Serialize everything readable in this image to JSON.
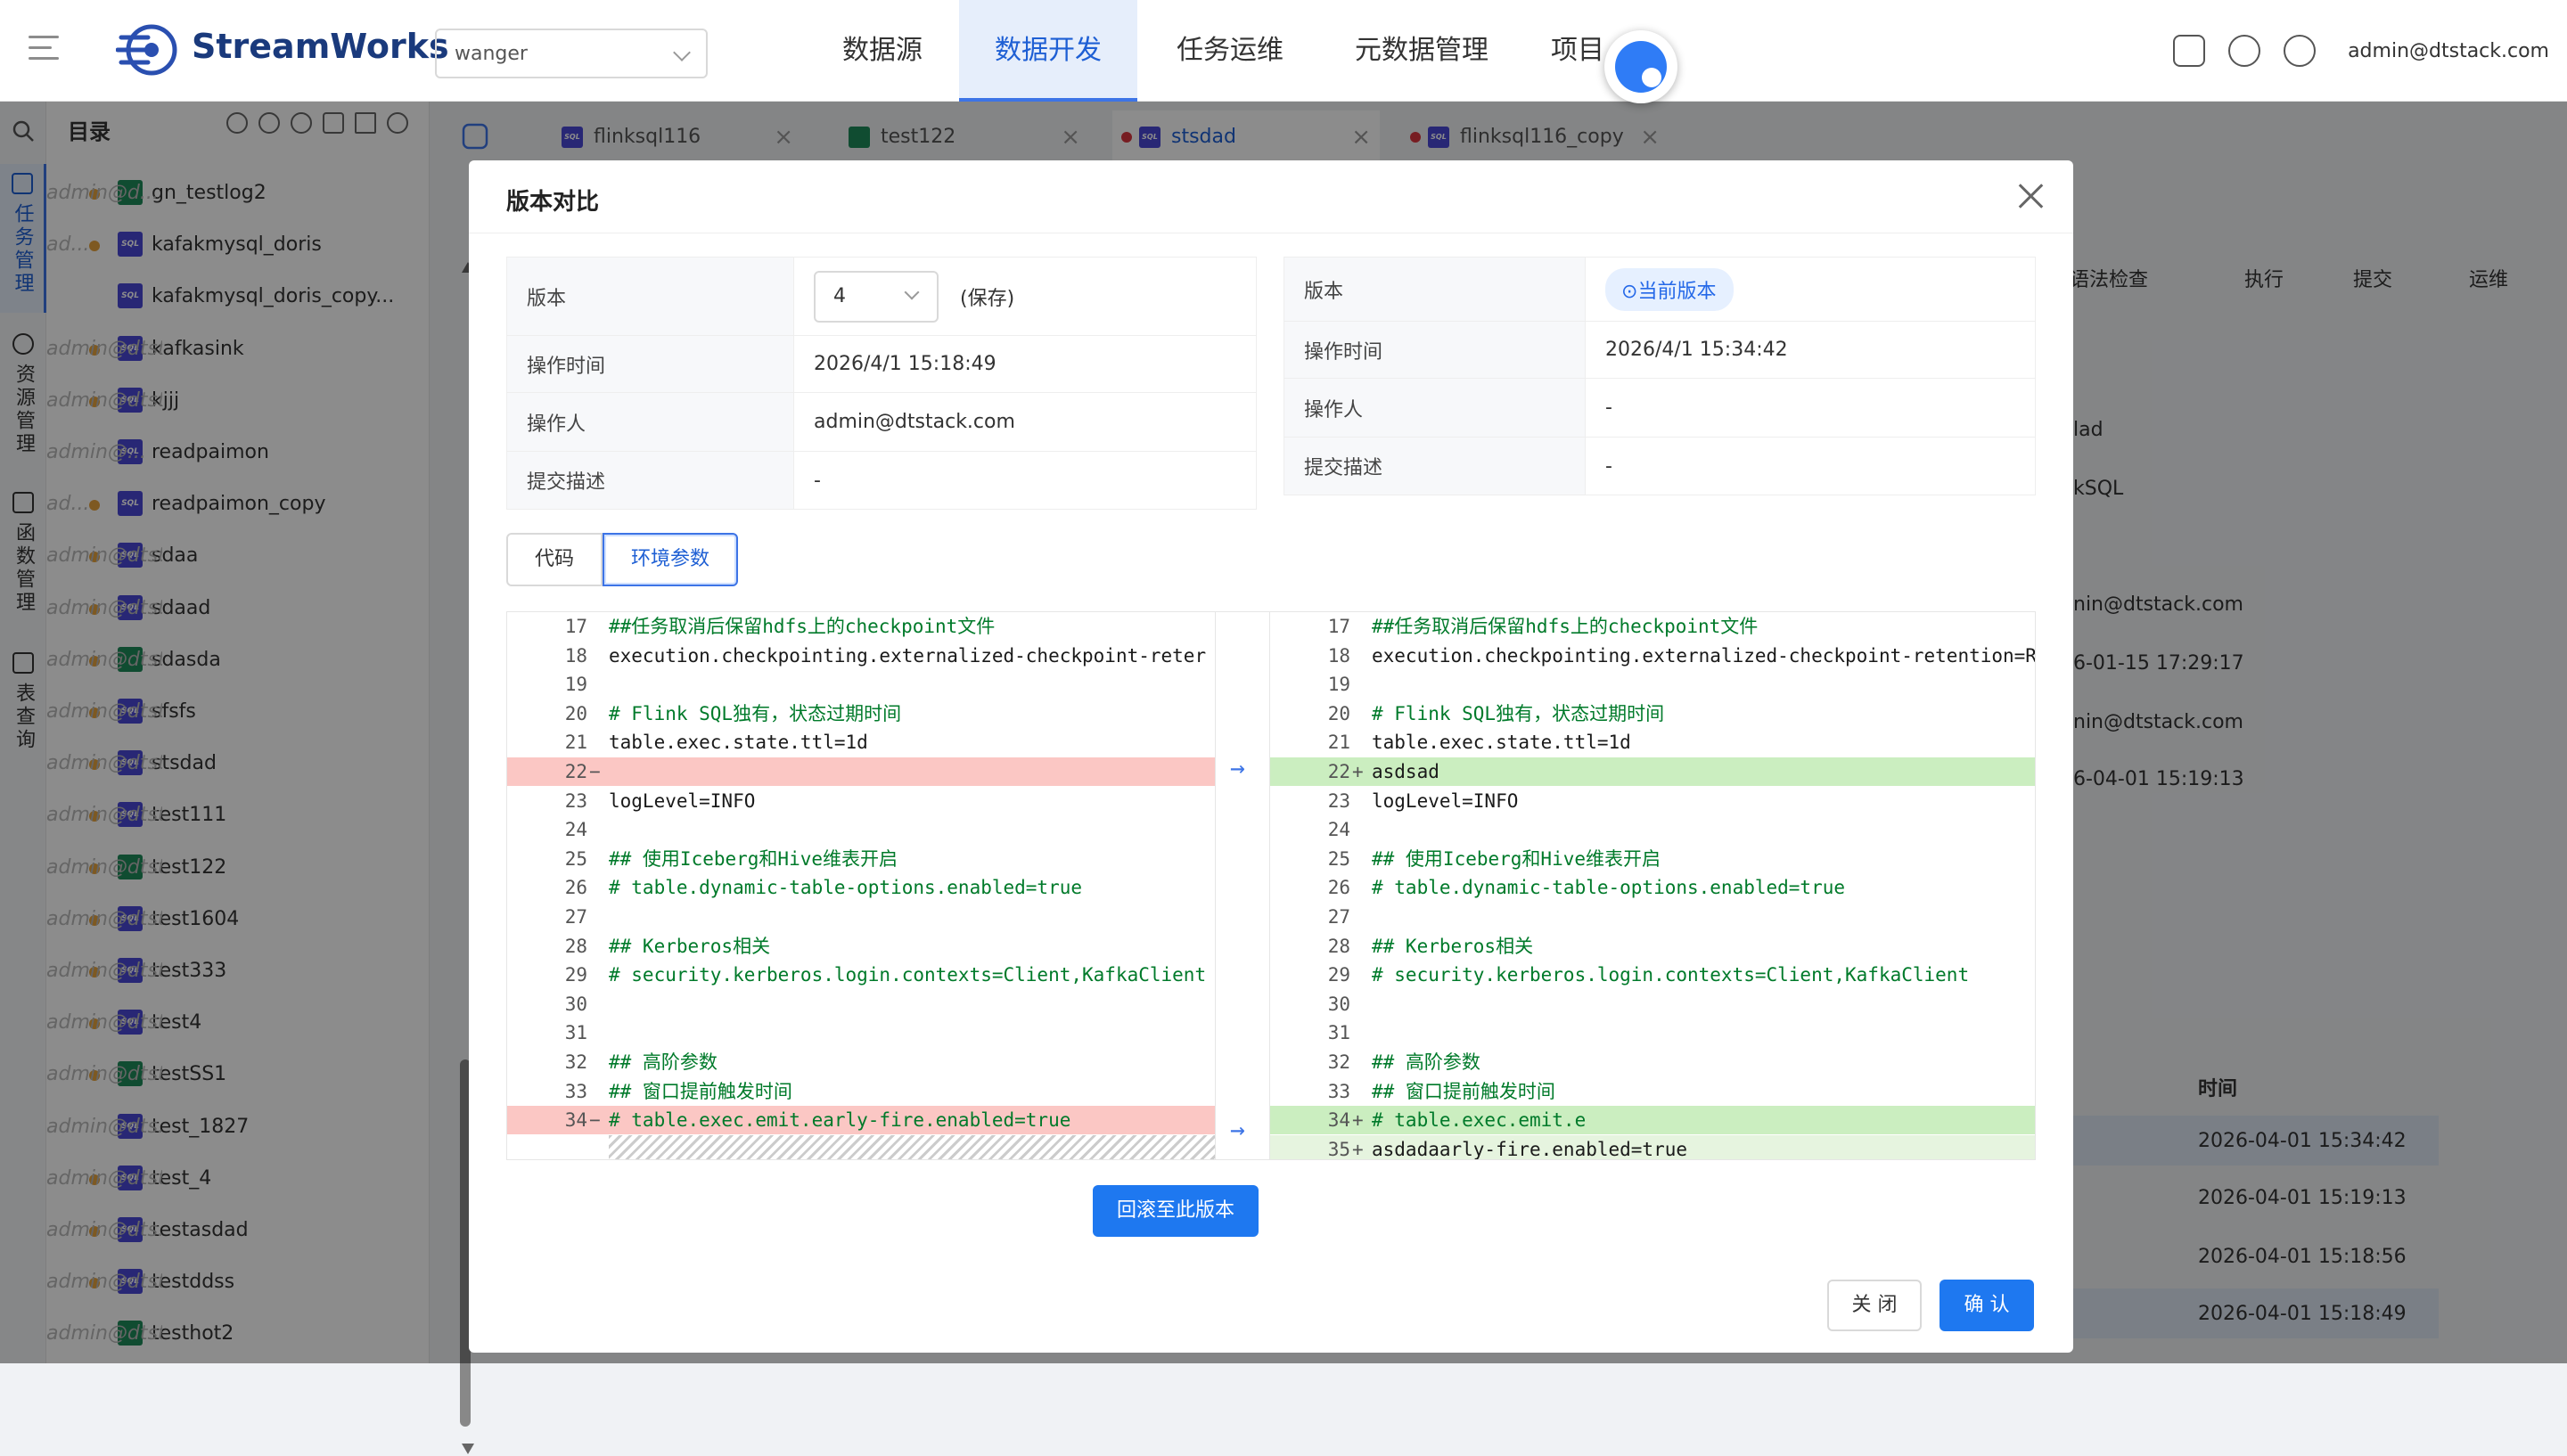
{
  "header": {
    "brand": "StreamWorks",
    "tenant": "wanger",
    "nav": [
      "数据源",
      "数据开发",
      "任务运维",
      "元数据管理",
      "项目"
    ],
    "active_nav": "数据开发",
    "user": "admin@dtstack.com"
  },
  "sidebar": {
    "items": [
      "任务管理",
      "资源管理",
      "函数管理",
      "表查询"
    ]
  },
  "tree": {
    "title": "目录",
    "items": [
      {
        "name": "gn_testlog2",
        "owner": "admin@d...",
        "type": "grid",
        "dot": true
      },
      {
        "name": "kafakmysql_doris",
        "owner": "ad...",
        "type": "sql",
        "dot": true
      },
      {
        "name": "kafakmysql_doris_copy...",
        "owner": "",
        "type": "sql",
        "dot": false
      },
      {
        "name": "kafkasink",
        "owner": "admin@dtst...",
        "type": "sql",
        "dot": true
      },
      {
        "name": "kjjj",
        "owner": "admin@dtstack.co...",
        "type": "sql",
        "dot": true
      },
      {
        "name": "readpaimon",
        "owner": "admin@...",
        "type": "sql",
        "dot": false
      },
      {
        "name": "readpaimon_copy",
        "owner": "ad...",
        "type": "sql",
        "dot": true
      },
      {
        "name": "sdaa",
        "owner": "admin@dtstack.c...",
        "type": "sql",
        "dot": true
      },
      {
        "name": "sdaad",
        "owner": "admin@dtstack...",
        "type": "sql",
        "dot": true
      },
      {
        "name": "sdasda",
        "owner": "admin@dtstac...",
        "type": "grid",
        "dot": true
      },
      {
        "name": "sfsfs",
        "owner": "admin@dtstack.c...",
        "type": "sql",
        "dot": true
      },
      {
        "name": "stsdad",
        "owner": "admin@dtstac...",
        "type": "sql",
        "dot": true
      },
      {
        "name": "test111",
        "owner": "admin@dtsta...",
        "type": "sql",
        "dot": true
      },
      {
        "name": "test122",
        "owner": "admin@dtsta...",
        "type": "grid",
        "dot": true
      },
      {
        "name": "test1604",
        "owner": "admin@dtst...",
        "type": "sql",
        "dot": true
      },
      {
        "name": "test333",
        "owner": "admin@dtsta...",
        "type": "sql",
        "dot": true
      },
      {
        "name": "test4",
        "owner": "admin@dtstack...",
        "type": "sql",
        "dot": true
      },
      {
        "name": "testSS1",
        "owner": "admin@dtsta...",
        "type": "grid",
        "dot": true
      },
      {
        "name": "test_1827",
        "owner": "admin@dts...",
        "type": "sql",
        "dot": false
      },
      {
        "name": "test_4",
        "owner": "admin@dtstack...",
        "type": "sql",
        "dot": true
      },
      {
        "name": "testasdad",
        "owner": "admin@dts...",
        "type": "sql",
        "dot": true
      },
      {
        "name": "testddss",
        "owner": "admin@dtst...",
        "type": "sql",
        "dot": true
      },
      {
        "name": "testhot2",
        "owner": "admin@dtst...",
        "type": "grid",
        "dot": false
      }
    ]
  },
  "tabs": [
    {
      "label": "flinksql116",
      "icon": "sql",
      "dirty": false
    },
    {
      "label": "test122",
      "icon": "grid",
      "dirty": false
    },
    {
      "label": "stsdad",
      "icon": "sql",
      "dirty": true
    },
    {
      "label": "flinksql116_copy",
      "icon": "sql",
      "dirty": true
    }
  ],
  "toolbar": [
    "语法检查",
    "执行",
    "提交",
    "运维"
  ],
  "bg_details": [
    "lad",
    "kSQL",
    "nin@dtstack.com",
    "6-01-15 17:29:17",
    "nin@dtstack.com",
    "6-04-01 15:19:13"
  ],
  "bg_history": {
    "col": "时间",
    "rows": [
      "2026-04-01 15:34:42",
      "2026-04-01 15:19:13",
      "2026-04-01 15:18:56",
      "2026-04-01 15:18:49"
    ]
  },
  "modal": {
    "title": "版本对比",
    "left": {
      "version_label": "版本",
      "version_value": "4",
      "version_note": "(保存)",
      "time_label": "操作时间",
      "time": "2026/4/1 15:18:49",
      "operator_label": "操作人",
      "operator": "admin@dtstack.com",
      "desc_label": "提交描述",
      "desc": "-"
    },
    "right": {
      "version_label": "版本",
      "current_badge": "当前版本",
      "time_label": "操作时间",
      "time": "2026/4/1 15:34:42",
      "operator_label": "操作人",
      "operator": "-",
      "desc_label": "提交描述",
      "desc": "-"
    },
    "tabs": [
      "代码",
      "环境参数"
    ],
    "active_tab": "环境参数",
    "left_lines": [
      {
        "n": "17",
        "t": "##任务取消后保留hdfs上的checkpoint文件",
        "k": "c"
      },
      {
        "n": "18",
        "t": "execution.checkpointing.externalized-checkpoint-reter",
        "k": ""
      },
      {
        "n": "19",
        "t": "",
        "k": ""
      },
      {
        "n": "20",
        "t": "# Flink SQL独有，状态过期时间",
        "k": "c"
      },
      {
        "n": "21",
        "t": "table.exec.state.ttl=1d",
        "k": ""
      },
      {
        "n": "22",
        "t": "",
        "k": "del"
      },
      {
        "n": "23",
        "t": "logLevel=INFO",
        "k": ""
      },
      {
        "n": "24",
        "t": "",
        "k": ""
      },
      {
        "n": "25",
        "t": "## 使用Iceberg和Hive维表开启",
        "k": "c"
      },
      {
        "n": "26",
        "t": "# table.dynamic-table-options.enabled=true",
        "k": "c"
      },
      {
        "n": "27",
        "t": "",
        "k": ""
      },
      {
        "n": "28",
        "t": "## Kerberos相关",
        "k": "c"
      },
      {
        "n": "29",
        "t": "# security.kerberos.login.contexts=Client,KafkaClient",
        "k": "c"
      },
      {
        "n": "30",
        "t": "",
        "k": ""
      },
      {
        "n": "31",
        "t": "",
        "k": ""
      },
      {
        "n": "32",
        "t": "## 高阶参数",
        "k": "c"
      },
      {
        "n": "33",
        "t": "## 窗口提前触发时间",
        "k": "c"
      },
      {
        "n": "34",
        "t": "# table.exec.emit.early-fire.enabled=true",
        "k": "delc"
      }
    ],
    "right_lines": [
      {
        "n": "17",
        "t": "##任务取消后保留hdfs上的checkpoint文件",
        "k": "c"
      },
      {
        "n": "18",
        "t": "execution.checkpointing.externalized-checkpoint-retention=RE",
        "k": ""
      },
      {
        "n": "19",
        "t": "",
        "k": ""
      },
      {
        "n": "20",
        "t": "# Flink SQL独有，状态过期时间",
        "k": "c"
      },
      {
        "n": "21",
        "t": "table.exec.state.ttl=1d",
        "k": ""
      },
      {
        "n": "22",
        "t": "asdsad",
        "k": "add"
      },
      {
        "n": "23",
        "t": "logLevel=INFO",
        "k": ""
      },
      {
        "n": "24",
        "t": "",
        "k": ""
      },
      {
        "n": "25",
        "t": "## 使用Iceberg和Hive维表开启",
        "k": "c"
      },
      {
        "n": "26",
        "t": "# table.dynamic-table-options.enabled=true",
        "k": "c"
      },
      {
        "n": "27",
        "t": "",
        "k": ""
      },
      {
        "n": "28",
        "t": "## Kerberos相关",
        "k": "c"
      },
      {
        "n": "29",
        "t": "# security.kerberos.login.contexts=Client,KafkaClient",
        "k": "c"
      },
      {
        "n": "30",
        "t": "",
        "k": ""
      },
      {
        "n": "31",
        "t": "",
        "k": ""
      },
      {
        "n": "32",
        "t": "## 高阶参数",
        "k": "c"
      },
      {
        "n": "33",
        "t": "## 窗口提前触发时间",
        "k": "c"
      },
      {
        "n": "34",
        "t": "# table.exec.emit.e",
        "k": "addc"
      },
      {
        "n": "35",
        "t": "asdadaarly-fire.enabled=true",
        "k": "add2"
      }
    ],
    "rollback": "回滚至此版本",
    "close": "关 闭",
    "ok": "确 认"
  }
}
